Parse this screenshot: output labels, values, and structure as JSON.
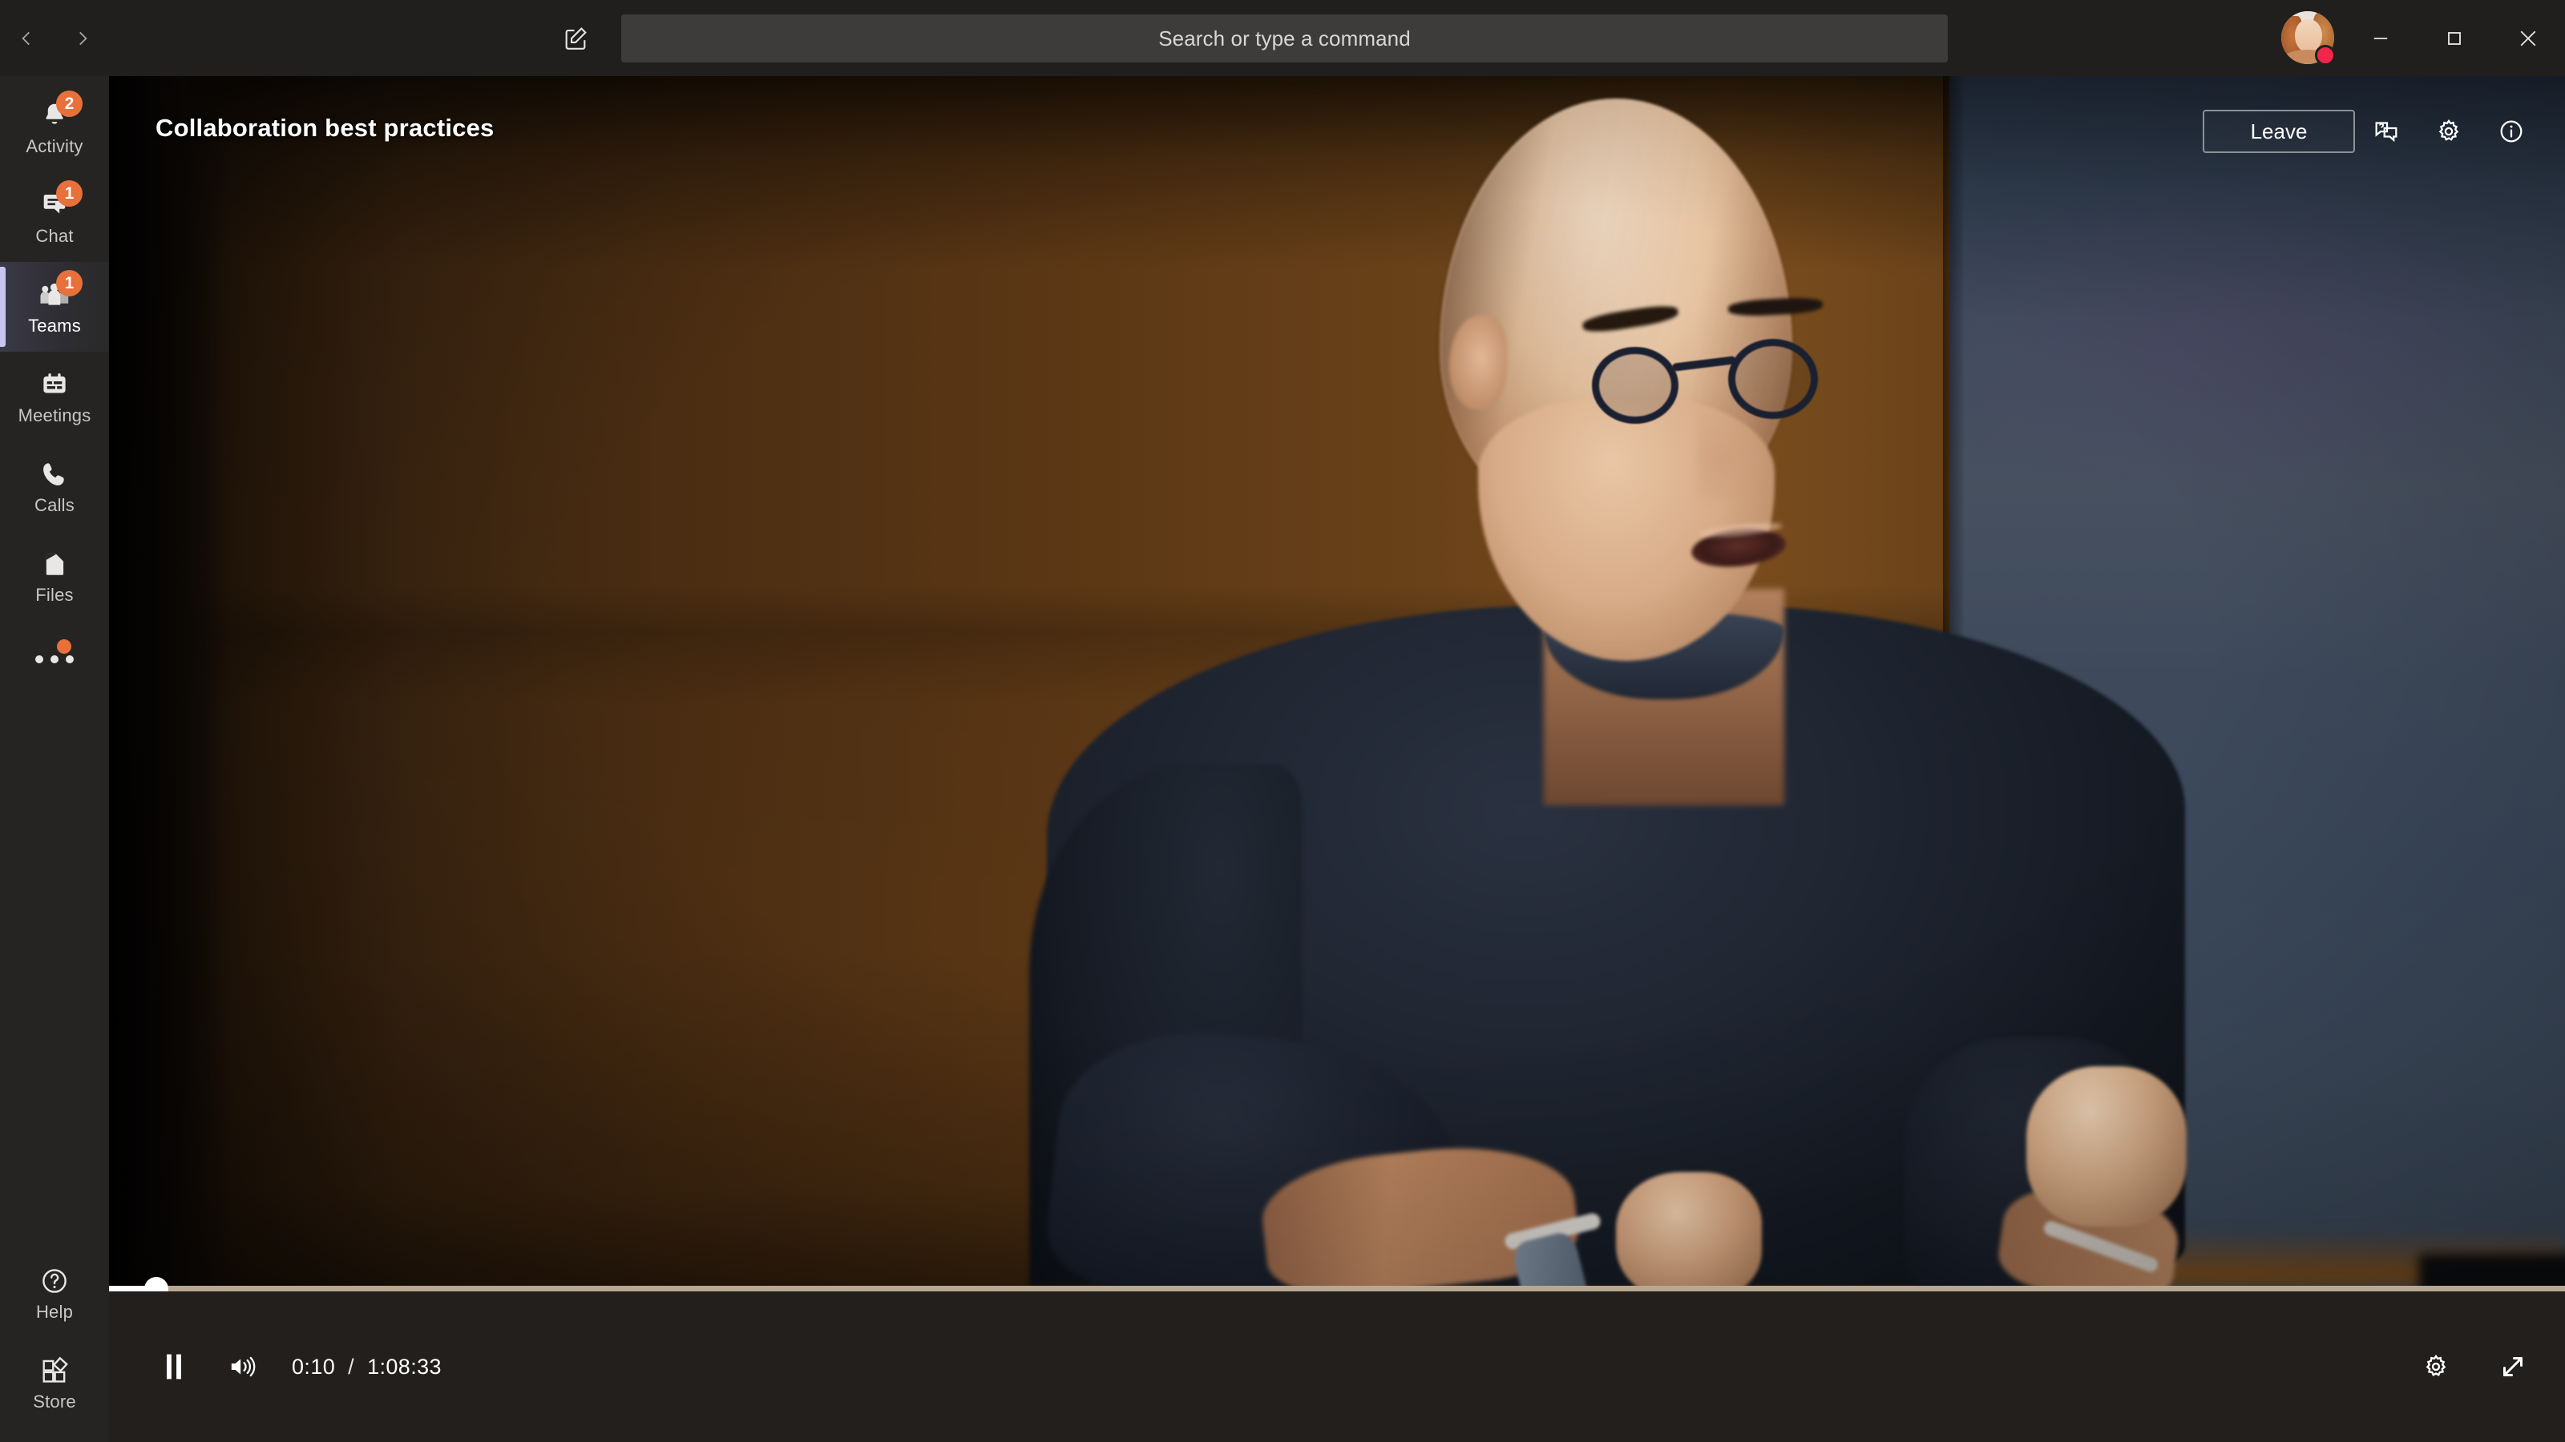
{
  "app": {
    "name": "Microsoft Teams",
    "accent_purple": "#c8c6f0",
    "badge_orange": "#e8703a",
    "status_busy_red": "#f1264a"
  },
  "titlebar": {
    "back_icon": "chevron-left-icon",
    "forward_icon": "chevron-right-icon",
    "compose_icon": "compose-new-chat-icon",
    "search": {
      "placeholder": "Search or type a command",
      "value": ""
    },
    "avatar": {
      "name": "avatar",
      "presence": "Busy",
      "presence_color": "#f1264a"
    },
    "window_controls": [
      {
        "name": "minimize-button",
        "glyph": "minimize-icon"
      },
      {
        "name": "maximize-button",
        "glyph": "maximize-icon"
      },
      {
        "name": "close-button",
        "glyph": "close-icon"
      }
    ]
  },
  "sidebar": {
    "items": [
      {
        "label": "Activity",
        "icon": "bell-icon",
        "badge": "2",
        "active": false
      },
      {
        "label": "Chat",
        "icon": "chat-bubble-icon",
        "badge": "1",
        "active": false
      },
      {
        "label": "Teams",
        "icon": "people-icon",
        "badge": "1",
        "active": true
      },
      {
        "label": "Meetings",
        "icon": "calendar-icon",
        "badge": "",
        "active": false
      },
      {
        "label": "Calls",
        "icon": "phone-icon",
        "badge": "",
        "active": false
      },
      {
        "label": "Files",
        "icon": "file-icon",
        "badge": "",
        "active": false
      }
    ],
    "more": {
      "label": "",
      "icon": "ellipsis-icon",
      "has_dot": true
    },
    "bottom_items": [
      {
        "label": "Help",
        "icon": "question-circle-icon"
      },
      {
        "label": "Store",
        "icon": "store-grid-icon"
      }
    ]
  },
  "meeting": {
    "title": "Collaboration best practices",
    "leave_label": "Leave",
    "actions": [
      {
        "name": "qna-button",
        "icon": "qna-chat-icon"
      },
      {
        "name": "meeting-settings-button",
        "icon": "gear-icon"
      },
      {
        "name": "meeting-info-button",
        "icon": "info-circle-icon"
      }
    ]
  },
  "player": {
    "play_state": "paused",
    "play_pause_icon": "pause-icon",
    "volume_icon": "volume-high-icon",
    "current_time": "0:10",
    "separator": "/",
    "duration": "1:08:33",
    "progress_percent": 0.24,
    "settings_icon": "gear-icon",
    "fullscreen_icon": "fullscreen-expand-icon"
  }
}
